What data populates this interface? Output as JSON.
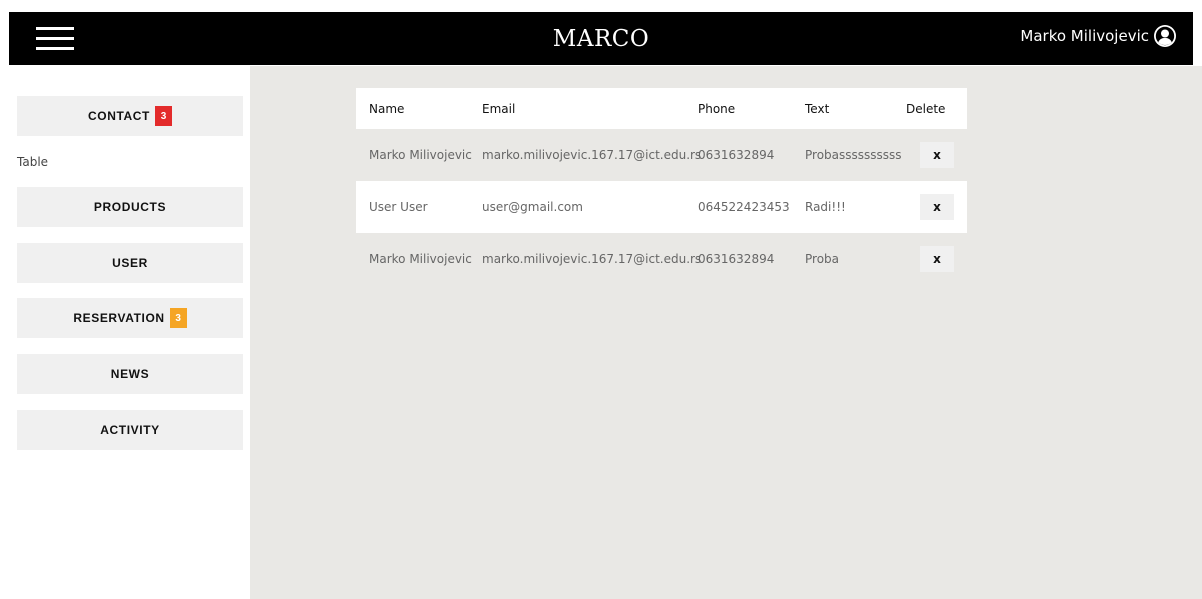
{
  "header": {
    "brand": "MARCO",
    "user_name": "Marko Milivojevic",
    "menu_icon": "hamburger-icon",
    "avatar_icon": "user-circle-icon"
  },
  "sidebar": {
    "items": [
      {
        "label": "CONTACT",
        "badge": "3",
        "badge_color": "#e32b2b"
      },
      {
        "label": "PRODUCTS"
      },
      {
        "label": "USER"
      },
      {
        "label": "RESERVATION",
        "badge": "3",
        "badge_color": "#f5a524"
      },
      {
        "label": "NEWS"
      },
      {
        "label": "ACTIVITY"
      }
    ],
    "sub_label": "Table"
  },
  "table": {
    "columns": [
      "Name",
      "Email",
      "Phone",
      "Text",
      "Delete"
    ],
    "rows": [
      {
        "name": "Marko Milivojevic",
        "email": "marko.milivojevic.167.17@ict.edu.rs",
        "phone": "0631632894",
        "text": "Probassssssssss",
        "delete": "x"
      },
      {
        "name": "User User",
        "email": "user@gmail.com",
        "phone": "064522423453",
        "text": "Radi!!!",
        "delete": "x"
      },
      {
        "name": "Marko Milivojevic",
        "email": "marko.milivojevic.167.17@ict.edu.rs",
        "phone": "0631632894",
        "text": "Proba",
        "delete": "x"
      }
    ]
  },
  "colors": {
    "header_bg": "#000000",
    "main_bg": "#e9e8e5",
    "menu_bg": "#f0f0f0"
  }
}
